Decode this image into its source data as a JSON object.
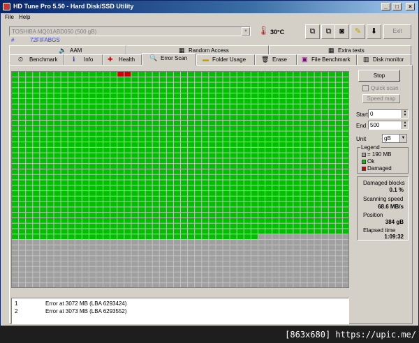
{
  "window": {
    "title": "HD Tune Pro 5.50 - Hard Disk/SSD Utility",
    "controls": [
      "_",
      "□",
      "×"
    ]
  },
  "menu": [
    "File",
    "Help"
  ],
  "toolbar": {
    "drive": "TOSHIBA MQ01ABD050 (500 gB)",
    "temperature": "30°C",
    "exit_label": "Exit"
  },
  "info": {
    "hash": "#",
    "firmware": "72FIFABGS"
  },
  "tabs_row1": [
    {
      "label": "AAM",
      "icon": "speaker-icon"
    },
    {
      "label": "Random Access",
      "icon": "grid-icon"
    },
    {
      "label": "Extra tests",
      "icon": "grid-icon"
    }
  ],
  "tabs_row2": [
    {
      "label": "Benchmark",
      "icon": "gauge-icon"
    },
    {
      "label": "Info",
      "icon": "info-icon"
    },
    {
      "label": "Health",
      "icon": "cross-icon"
    },
    {
      "label": "Error Scan",
      "icon": "magnifier-icon",
      "active": true
    },
    {
      "label": "Folder Usage",
      "icon": "folder-icon"
    },
    {
      "label": "Erase",
      "icon": "trash-icon"
    },
    {
      "label": "File Benchmark",
      "icon": "file-icon"
    },
    {
      "label": "Disk monitor",
      "icon": "chart-icon"
    }
  ],
  "controls": {
    "stop_label": "Stop",
    "quick_scan_label": "Quick scan",
    "speed_map_label": "Speed map",
    "start_label": "Start",
    "start_value": "0",
    "end_label": "End",
    "end_value": "500",
    "unit_label": "Unit",
    "unit_value": "gB"
  },
  "legend": {
    "title": "Legend",
    "items": [
      {
        "label": "= 190 MB",
        "color": "#a0a0a0"
      },
      {
        "label": "Ok",
        "color": "#00c000"
      },
      {
        "label": "Damaged",
        "color": "#d00000"
      }
    ]
  },
  "stats": {
    "damaged_blocks_label": "Damaged blocks",
    "damaged_blocks_value": "0.1 %",
    "scanning_speed_label": "Scanning speed",
    "scanning_speed_value": "68.6 MB/s",
    "position_label": "Position",
    "position_value": "384 gB",
    "elapsed_label": "Elapsed time",
    "elapsed_value": "1:09:32"
  },
  "scan": {
    "ok_color": "#00c000",
    "damaged_color": "#d00000",
    "pending_color": "#a0a0a0",
    "progress_fraction": 0.768
  },
  "errors": [
    {
      "num": "1",
      "text": "Error at 3072 MB (LBA 6293424)"
    },
    {
      "num": "2",
      "text": "Error at 3073 MB (LBA 6293552)"
    }
  ],
  "caption": "[863x680] https://upic.me/"
}
